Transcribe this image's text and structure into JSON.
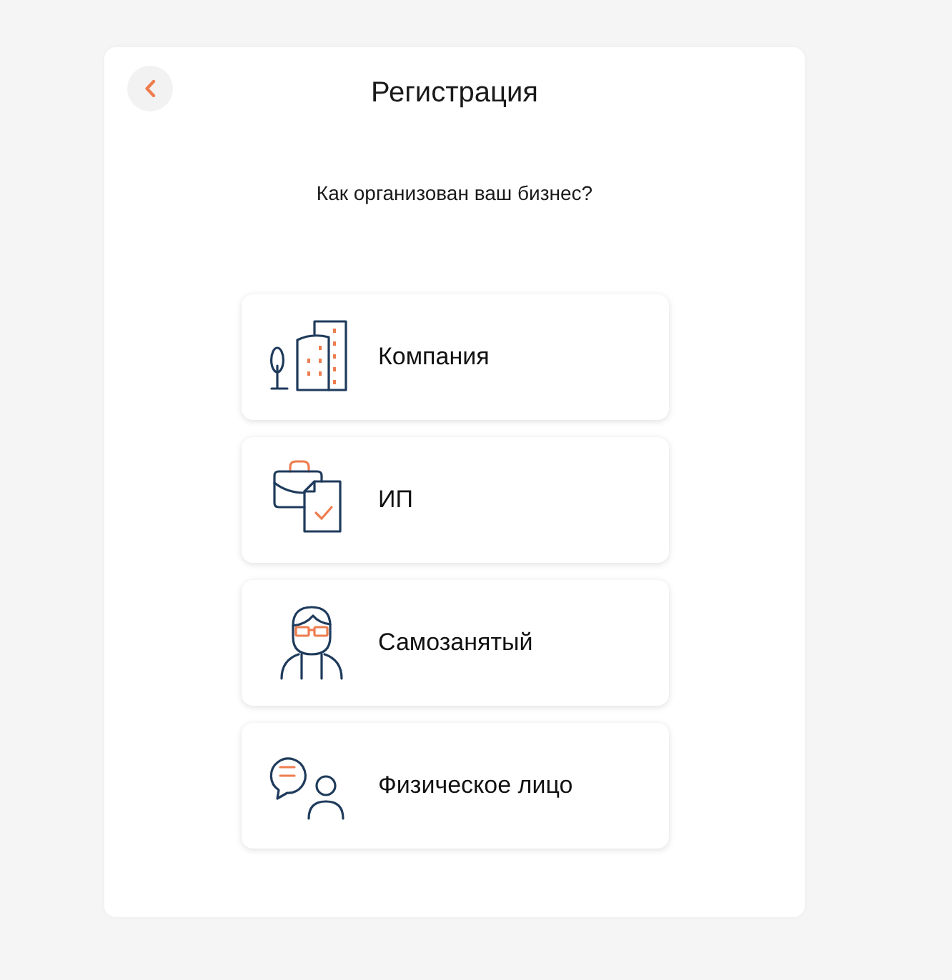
{
  "header": {
    "title": "Регистрация"
  },
  "question": "Как организован ваш бизнес?",
  "options": [
    {
      "kind": "company",
      "label": "Компания"
    },
    {
      "kind": "entrepreneur",
      "label": "ИП"
    },
    {
      "kind": "self_employed",
      "label": "Самозанятый"
    },
    {
      "kind": "individual",
      "label": "Физическое лицо"
    }
  ]
}
